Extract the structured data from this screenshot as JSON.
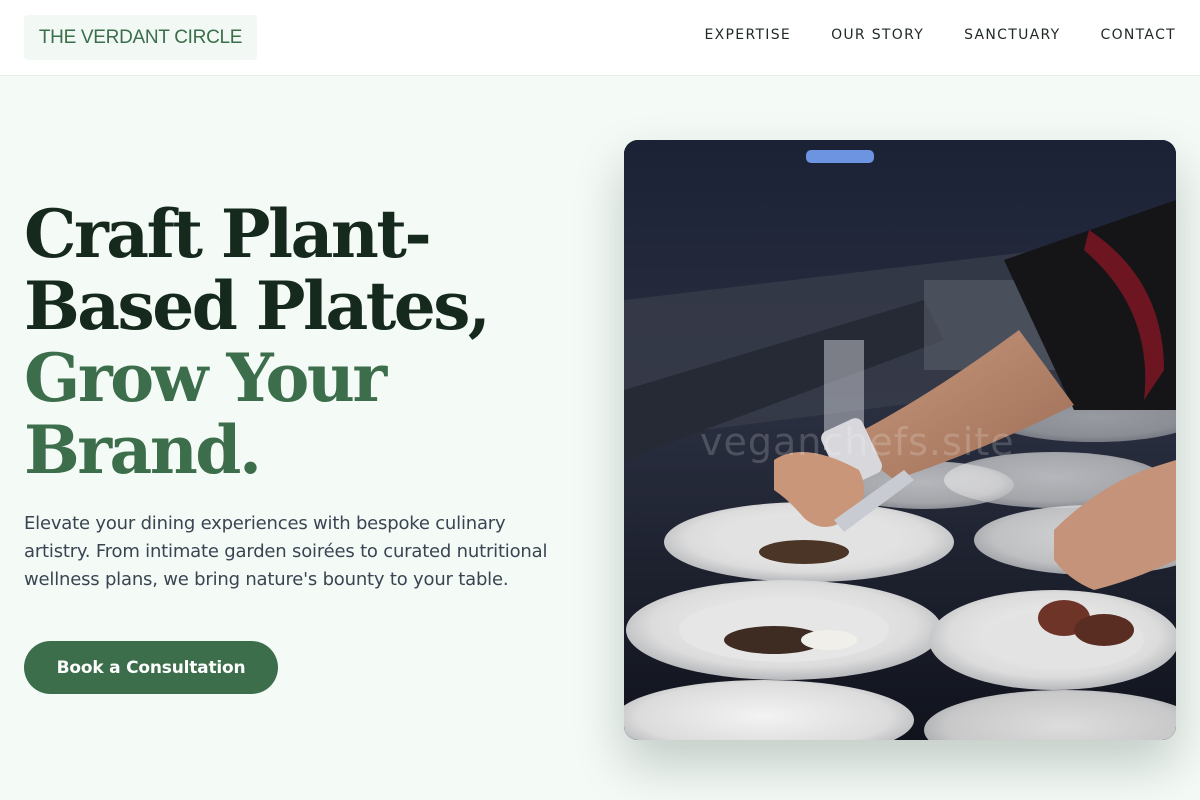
{
  "header": {
    "logo": "THE VERDANT CIRCLE",
    "nav": [
      "EXPERTISE",
      "OUR STORY",
      "SANCTUARY",
      "CONTACT"
    ]
  },
  "hero": {
    "headline_dark_1": "Craft Plant-",
    "headline_dark_2": "Based Plates,",
    "headline_green_1": "Grow Your",
    "headline_green_2": "Brand.",
    "description": "Elevate your dining experiences with bespoke culinary artistry. From intimate garden soirées to curated nutritional wellness plans, we bring nature's bounty to your table.",
    "cta_label": "Book a Consultation",
    "image_watermark": "veganchefs.site"
  },
  "colors": {
    "brand_green": "#3c6e4b",
    "headline_dark": "#16291d",
    "page_bg": "#f4faf6"
  }
}
